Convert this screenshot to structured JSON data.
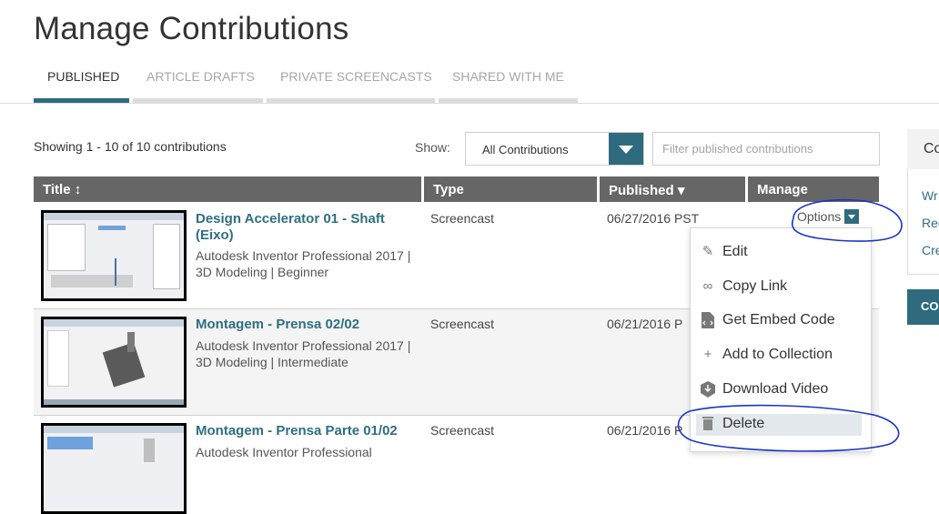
{
  "page": {
    "title": "Manage Contributions"
  },
  "tabs": [
    {
      "label": "PUBLISHED",
      "active": true
    },
    {
      "label": "ARTICLE DRAFTS",
      "active": false
    },
    {
      "label": "PRIVATE SCREENCASTS",
      "active": false
    },
    {
      "label": "SHARED WITH ME",
      "active": false
    }
  ],
  "toolbar": {
    "showing_text": "Showing 1 - 10 of 10 contributions",
    "show_label": "Show:",
    "show_value": "All Contributions",
    "filter_placeholder": "Filter published contributions"
  },
  "table": {
    "headers": [
      "Title ↕",
      "Type",
      "Published ▾",
      "Manage"
    ],
    "rows": [
      {
        "title": "Design Accelerator 01 - Shaft (Eixo)",
        "meta": "Autodesk Inventor Professional 2017 | 3D Modeling | Beginner",
        "type": "Screencast",
        "date": "06/27/2016 PST"
      },
      {
        "title": "Montagem - Prensa 02/02",
        "meta": "Autodesk Inventor Professional 2017 | 3D Modeling | Intermediate",
        "type": "Screencast",
        "date": "06/21/2016 P"
      },
      {
        "title": "Montagem - Prensa Parte 01/02",
        "meta": "Autodesk Inventor Professional",
        "type": "Screencast",
        "date": "06/21/2016 P"
      }
    ]
  },
  "options": {
    "label": "Options"
  },
  "menu": {
    "items": [
      {
        "label": "Edit",
        "icon": "pencil-icon"
      },
      {
        "label": "Copy Link",
        "icon": "link-icon"
      },
      {
        "label": "Get Embed Code",
        "icon": "code-file-icon"
      },
      {
        "label": "Add to Collection",
        "icon": "plus-icon"
      },
      {
        "label": "Download Video",
        "icon": "download-box-icon"
      },
      {
        "label": "Delete",
        "icon": "trash-icon",
        "highlighted": true
      }
    ]
  },
  "side": {
    "head": "Co",
    "links": [
      "Wr",
      "Rec",
      "Cre"
    ],
    "button": "CO"
  },
  "colors": {
    "accent": "#2f6b7e",
    "link": "#2e6f82",
    "table_header": "#666666",
    "annotation": "#1a33c8"
  }
}
